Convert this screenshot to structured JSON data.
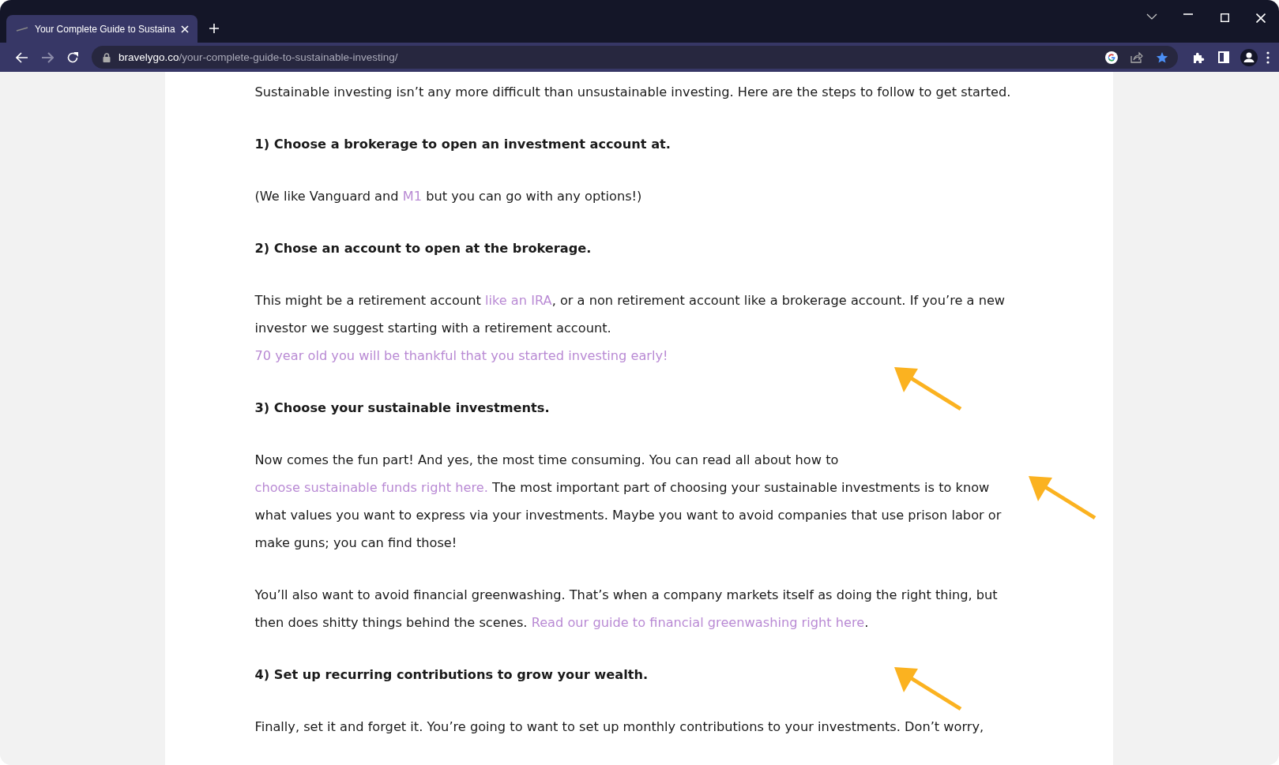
{
  "browser": {
    "tabs": [
      {
        "title": "Your Complete Guide to Sustaina",
        "selected": true
      }
    ],
    "forward_disabled": true,
    "address": {
      "domain": "bravelygo.co",
      "path": "/your-complete-guide-to-sustainable-investing/"
    },
    "bookmarked": true
  },
  "article": {
    "blocks": [
      {
        "kind": "paragraph",
        "segments": [
          {
            "kind": "text",
            "text": "Sustainable investing isn’t any more difficult than unsustainable investing. Here are the steps to follow to get started."
          }
        ]
      },
      {
        "kind": "heading",
        "segments": [
          {
            "kind": "text",
            "text": "1) Choose a brokerage to open an investment account at."
          }
        ]
      },
      {
        "kind": "paragraph",
        "segments": [
          {
            "kind": "text",
            "text": "(We like Vanguard and "
          },
          {
            "kind": "link",
            "text": "M1"
          },
          {
            "kind": "text",
            "text": " but you can go with any options!)"
          }
        ]
      },
      {
        "kind": "heading",
        "segments": [
          {
            "kind": "text",
            "text": "2) Chose an account to open at the brokerage."
          }
        ]
      },
      {
        "kind": "paragraph",
        "segments": [
          {
            "kind": "text",
            "text": "This might be a retirement account "
          },
          {
            "kind": "link",
            "text": "like an IRA"
          },
          {
            "kind": "text",
            "text": ", or a non retirement account like a brokerage account. If you’re a new investor we suggest starting with a retirement account. "
          },
          {
            "kind": "link",
            "text": "70 year old you will be thankful that you started investing early!"
          }
        ]
      },
      {
        "kind": "heading",
        "segments": [
          {
            "kind": "text",
            "text": "3) Choose your sustainable investments."
          }
        ]
      },
      {
        "kind": "paragraph",
        "segments": [
          {
            "kind": "text",
            "text": "Now comes the fun part! And yes, the most time consuming. You can read all about how to "
          },
          {
            "kind": "link",
            "text": "choose sustainable funds right here."
          },
          {
            "kind": "text",
            "text": " The most important part of choosing your sustainable investments is to know what values you want to express via your investments. Maybe you want to avoid companies that use prison labor or make guns; you can find those!"
          }
        ]
      },
      {
        "kind": "paragraph",
        "segments": [
          {
            "kind": "text",
            "text": "You’ll also want to avoid financial greenwashing. That’s when a company markets itself as doing the right thing, but then does shitty things behind the scenes. "
          },
          {
            "kind": "link",
            "text": "Read our guide to financial greenwashing right here"
          },
          {
            "kind": "text",
            "text": "."
          }
        ]
      },
      {
        "kind": "heading",
        "segments": [
          {
            "kind": "text",
            "text": "4) Set up recurring contributions to grow your wealth."
          }
        ]
      },
      {
        "kind": "paragraph",
        "segments": [
          {
            "kind": "text",
            "text": "Finally, set it and forget it. You’re going to want to set up monthly contributions to your investments. Don’t worry,"
          }
        ]
      }
    ]
  }
}
